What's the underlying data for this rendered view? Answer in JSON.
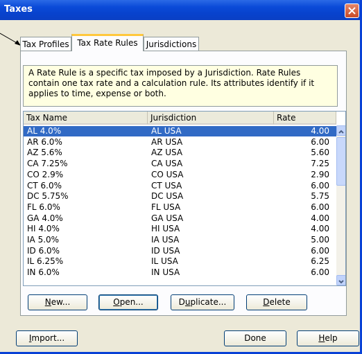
{
  "window": {
    "title": "Taxes"
  },
  "tabs": [
    {
      "label": "Tax Profiles"
    },
    {
      "label": "Tax Rate Rules"
    },
    {
      "label": "Jurisdictions"
    }
  ],
  "description": "A Rate Rule is a specific tax imposed by a Jurisdiction. Rate Rules contain one tax rate and a calculation rule. Its attributes identify if it applies to time, expense or both.",
  "table": {
    "columns": [
      "Tax Name",
      "Jurisdiction",
      "Rate"
    ],
    "rows": [
      [
        "AL 4.0%",
        "AL USA",
        "4.00"
      ],
      [
        "AR 6.0%",
        "AR USA",
        "6.00"
      ],
      [
        "AZ 5.6%",
        "AZ USA",
        "5.60"
      ],
      [
        "CA 7.25%",
        "CA USA",
        "7.25"
      ],
      [
        "CO 2.9%",
        "CO USA",
        "2.90"
      ],
      [
        "CT 6.0%",
        "CT USA",
        "6.00"
      ],
      [
        "DC 5.75%",
        "DC USA",
        "5.75"
      ],
      [
        "FL 6.0%",
        "FL USA",
        "6.00"
      ],
      [
        "GA 4.0%",
        "GA USA",
        "4.00"
      ],
      [
        "HI 4.0%",
        "HI USA",
        "4.00"
      ],
      [
        "IA 5.0%",
        "IA USA",
        "5.00"
      ],
      [
        "ID 6.0%",
        "ID USA",
        "6.00"
      ],
      [
        "IL 6.25%",
        "IL USA",
        "6.25"
      ],
      [
        "IN 6.0%",
        "IN USA",
        "6.00"
      ]
    ],
    "selected_row": 0
  },
  "buttons": {
    "new": {
      "pre": "",
      "key": "N",
      "post": "ew..."
    },
    "open": {
      "pre": "",
      "key": "O",
      "post": "pen..."
    },
    "duplicate": {
      "pre": "D",
      "key": "u",
      "post": "plicate..."
    },
    "delete": {
      "pre": "",
      "key": "D",
      "post": "elete"
    },
    "import": {
      "pre": "",
      "key": "I",
      "post": "mport..."
    },
    "done": {
      "label": "Done"
    },
    "help": {
      "pre": "",
      "key": "H",
      "post": "elp"
    }
  },
  "colors": {
    "titlebar": "#0a4ad8",
    "selection": "#316ac5",
    "active_tab_accent": "#ffc83c"
  }
}
